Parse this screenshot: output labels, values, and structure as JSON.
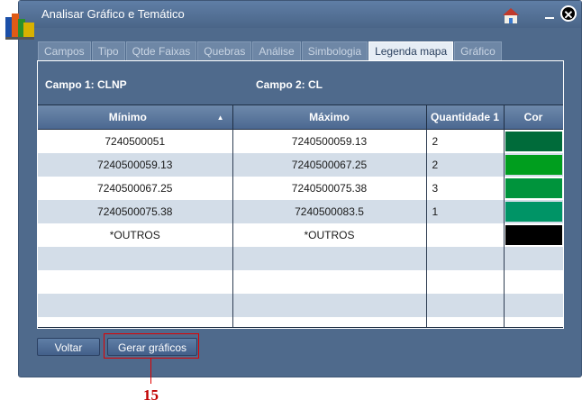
{
  "window": {
    "title": "Analisar Gráfico e Temático"
  },
  "tabs": [
    "Campos",
    "Tipo",
    "Qtde Faixas",
    "Quebras",
    "Análise",
    "Simbologia",
    "Legenda mapa",
    "Gráfico"
  ],
  "active_tab": "Legenda mapa",
  "campos": {
    "campo1": "Campo 1: CLNP",
    "campo2": "Campo 2: CL"
  },
  "table": {
    "headers": [
      "Mínimo",
      "Máximo",
      "Quantidade 1",
      "Cor"
    ],
    "sorted_column": "Mínimo",
    "rows": [
      {
        "minimo": "7240500051",
        "maximo": "7240500059.13",
        "quantidade": "2",
        "cor": "#006b3a"
      },
      {
        "minimo": "7240500059.13",
        "maximo": "7240500067.25",
        "quantidade": "2",
        "cor": "#009e1e"
      },
      {
        "minimo": "7240500067.25",
        "maximo": "7240500075.38",
        "quantidade": "3",
        "cor": "#00943c"
      },
      {
        "minimo": "7240500075.38",
        "maximo": "7240500083.5",
        "quantidade": "1",
        "cor": "#009466"
      },
      {
        "minimo": "*OUTROS",
        "maximo": "*OUTROS",
        "quantidade": "",
        "cor": "#000000"
      }
    ],
    "empty_rows": 4
  },
  "buttons": {
    "voltar": "Voltar",
    "gerar": "Gerar gráficos"
  },
  "annotation": {
    "number": "15",
    "color": "#e00000"
  }
}
